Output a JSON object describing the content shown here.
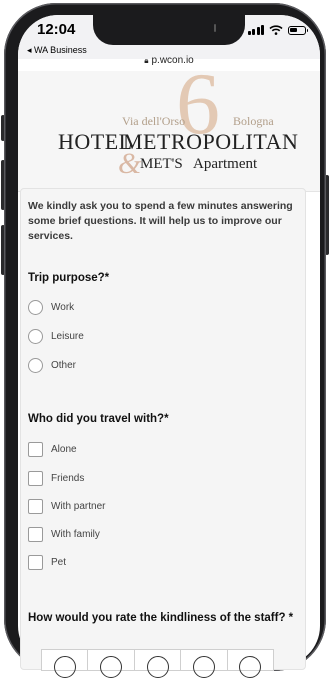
{
  "status_bar": {
    "time": "12:04",
    "back_app": "◂ WA Business",
    "url": "p.wcon.io"
  },
  "logo": {
    "six": "6",
    "via": "Via dell'Orso",
    "city": "Bologna",
    "hotel": "HOTEL",
    "metropolitan": "METROPOLITAN",
    "ampersand": "&",
    "mets": "MET'S",
    "apartment": "Apartment"
  },
  "form": {
    "intro": "We kindly ask you to spend a few minutes answering some brief questions. It will help us to improve our services.",
    "q1": {
      "label": "Trip purpose?*",
      "options": [
        "Work",
        "Leisure",
        "Other"
      ]
    },
    "q2": {
      "label": "Who did you travel with?*",
      "options": [
        "Alone",
        "Friends",
        "With partner",
        "With family",
        "Pet"
      ]
    },
    "q3": {
      "label": "How would you rate the kindliness of the staff? *"
    }
  },
  "colors": {
    "accent_logo": "#d9b8a4",
    "background": "#f5f5f5"
  },
  "icons": {
    "signal": "cellular-signal-icon",
    "wifi": "wifi-icon",
    "battery": "battery-icon",
    "lock": "lock-icon"
  }
}
